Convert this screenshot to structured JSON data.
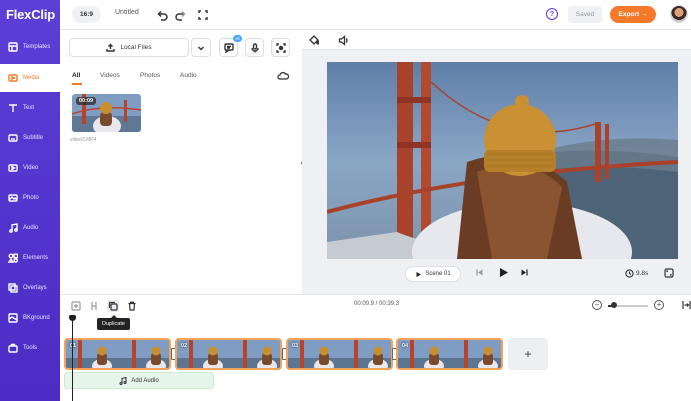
{
  "app": {
    "logo": "FlexClip"
  },
  "colors": {
    "brand_purple": "#5b3fd6",
    "accent_orange": "#f47a2a",
    "audio_green": "#e6f5ea"
  },
  "sidebar": {
    "items": [
      {
        "label": "Templates",
        "icon": "templates-icon"
      },
      {
        "label": "Media",
        "icon": "media-icon",
        "active": true
      },
      {
        "label": "Text",
        "icon": "text-icon"
      },
      {
        "label": "Subtitle",
        "icon": "subtitle-icon"
      },
      {
        "label": "Video",
        "icon": "video-icon"
      },
      {
        "label": "Photo",
        "icon": "photo-icon"
      },
      {
        "label": "Audio",
        "icon": "audio-icon"
      },
      {
        "label": "Elements",
        "icon": "elements-icon"
      },
      {
        "label": "Overlays",
        "icon": "overlays-icon"
      },
      {
        "label": "BKground",
        "icon": "background-icon"
      },
      {
        "label": "Tools",
        "icon": "tools-icon"
      }
    ]
  },
  "header": {
    "aspect_ratio": "16:9",
    "project_title": "Untitled",
    "saved_label": "Saved",
    "export_label": "Export →"
  },
  "media": {
    "local_files_label": "Local Files",
    "ai_badge": "AI",
    "tabs": [
      "All",
      "Videos",
      "Photos",
      "Audio"
    ],
    "active_tab": "All",
    "items": [
      {
        "duration": "00:09",
        "filename": "video2.MP4"
      }
    ]
  },
  "preview": {
    "scene_label": "Scene 01",
    "duration": "9.8s"
  },
  "timeline": {
    "time_readout": "00:00.9 / 00:39.3",
    "tooltip": "Duplicate",
    "clips": [
      "01",
      "02",
      "03",
      "04"
    ],
    "add_scene_label": "+",
    "add_audio_label": "Add Audio",
    "zoom_level": 0.15
  }
}
